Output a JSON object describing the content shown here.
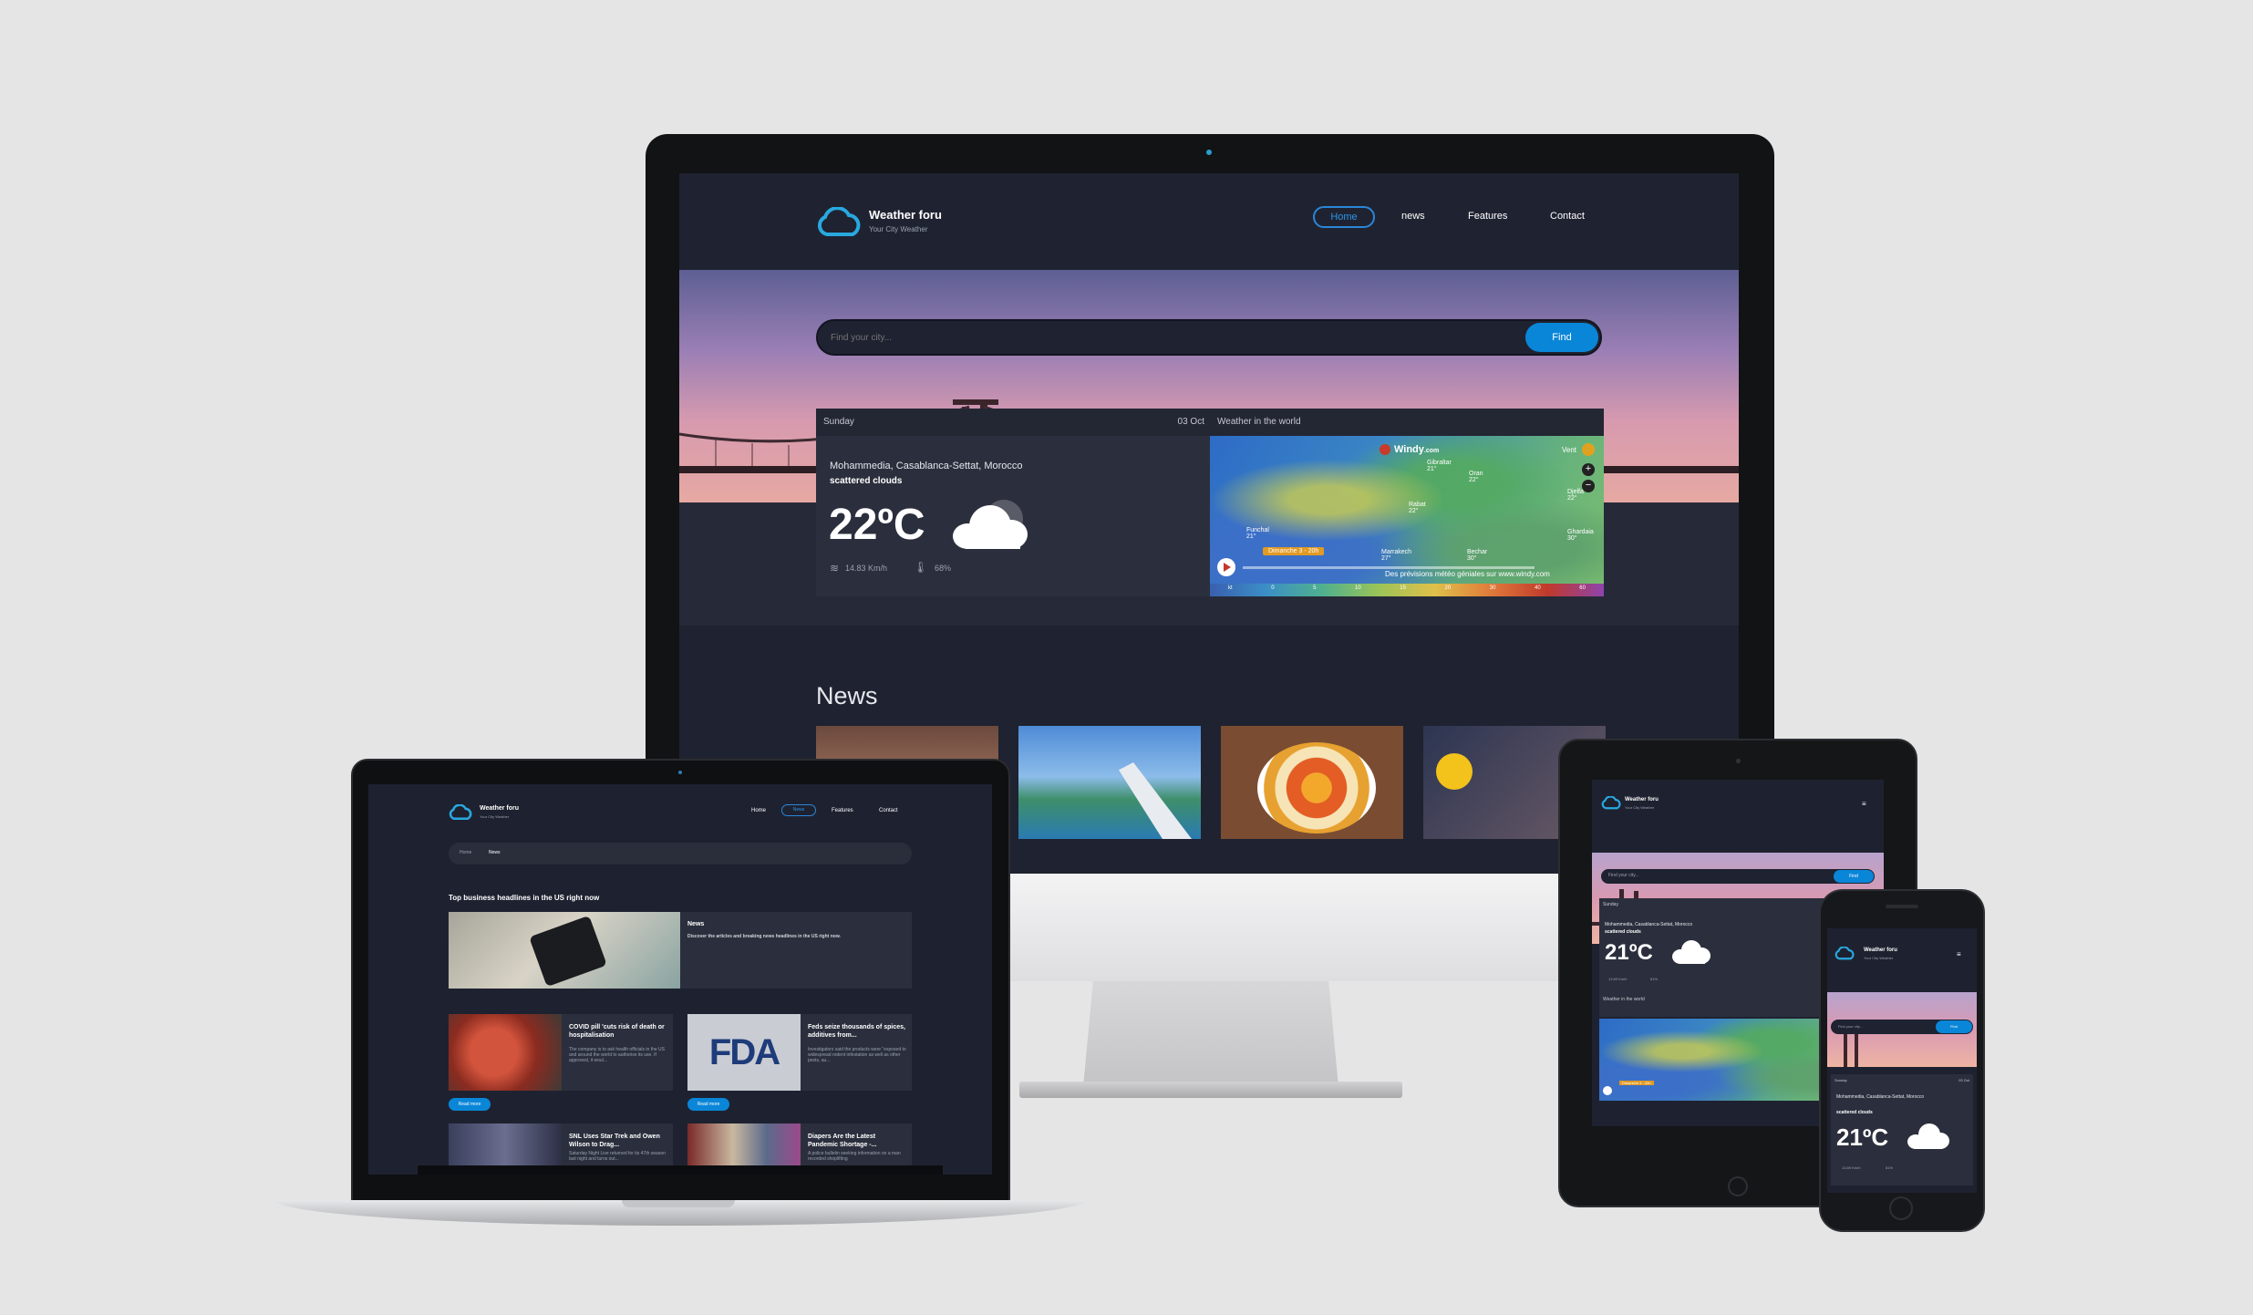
{
  "brand": {
    "name": "Weather foru",
    "tagline": "Your City Weather"
  },
  "nav": {
    "home": "Home",
    "news": "news",
    "features": "Features",
    "contact": "Contact"
  },
  "nav_short": {
    "news": "News"
  },
  "search": {
    "placeholder": "Find your city...",
    "button": "Find"
  },
  "weather": {
    "day": "Sunday",
    "date": "03 Oct",
    "location": "Mohammedia, Casablanca-Settat, Morocco",
    "condition": "scattered clouds",
    "temp": "22ºC",
    "wind": "14.83 Km/h",
    "humidity": "68%",
    "world_title": "Weather in the world"
  },
  "map": {
    "brand": "Windy",
    "brand_suffix": ".com",
    "layer": "Vent",
    "date_chip": "Dimanche 3 - 20h",
    "footer": "Des prévisions météo géniales sur www.windy.com",
    "cities": [
      {
        "name": "Gibraltar",
        "t": "21°"
      },
      {
        "name": "Oran",
        "t": "22°"
      },
      {
        "name": "Funchal",
        "t": "21°"
      },
      {
        "name": "Rabat",
        "t": "22°"
      },
      {
        "name": "Marrakech",
        "t": "27°"
      },
      {
        "name": "Bechar",
        "t": "30°"
      },
      {
        "name": "Ghardaia",
        "t": "30°"
      },
      {
        "name": "Djelfa",
        "t": "22°"
      }
    ],
    "scale": [
      "kt",
      "0",
      "5",
      "10",
      "15",
      "20",
      "30",
      "40",
      "60"
    ]
  },
  "news": {
    "heading": "News"
  },
  "laptop": {
    "breadcrumb_home": "Home",
    "breadcrumb_current": "News",
    "headline": "Top business headlines in the US right now",
    "feature_title": "News",
    "feature_desc": "Discover the articles and breaking news headlines in the US right now.",
    "read_more": "Read more",
    "articles": [
      {
        "title": "COVID pill 'cuts risk of death or hospitalisation",
        "desc": "The company is to ask health officials in the US and around the world to authorise its use. If approved, it woul..."
      },
      {
        "title": "Feds seize thousands of spices, additives from...",
        "desc": "Investigators said the products were \"exposed to widespread rodent infestation as well as other pests, au..."
      },
      {
        "title": "SNL Uses Star Trek and Owen Wilson to Drag...",
        "desc": "Saturday Night Live returned for its 47th season last night and turns out..."
      },
      {
        "title": "Diapers Are the Latest Pandemic Shortage -...",
        "desc": "A police bulletin seeking information on a man recorded shoplifting"
      }
    ],
    "fda_logo": "FDA"
  },
  "tablet": {
    "day": "Sunday",
    "location": "Mohammedia, Casablanca-Settat, Morocco",
    "condition": "scattered clouds",
    "temp": "21ºC",
    "wind": "13.89 Km/h",
    "humidity": "81%",
    "world_title": "Weather in the world",
    "date_chip": "Dimanche 3 - 20h"
  },
  "phone": {
    "day": "Sunday",
    "date": "03 Oct",
    "location": "Mohammedia, Casablanca-Settat, Morocco",
    "condition": "scattered clouds",
    "temp": "21ºC",
    "wind": "13.89 Km/h",
    "humidity": "81%"
  },
  "colors": {
    "accent": "#0a86d8",
    "bg": "#1e2230",
    "panel": "#2b2f3d",
    "frame": "#111214"
  }
}
